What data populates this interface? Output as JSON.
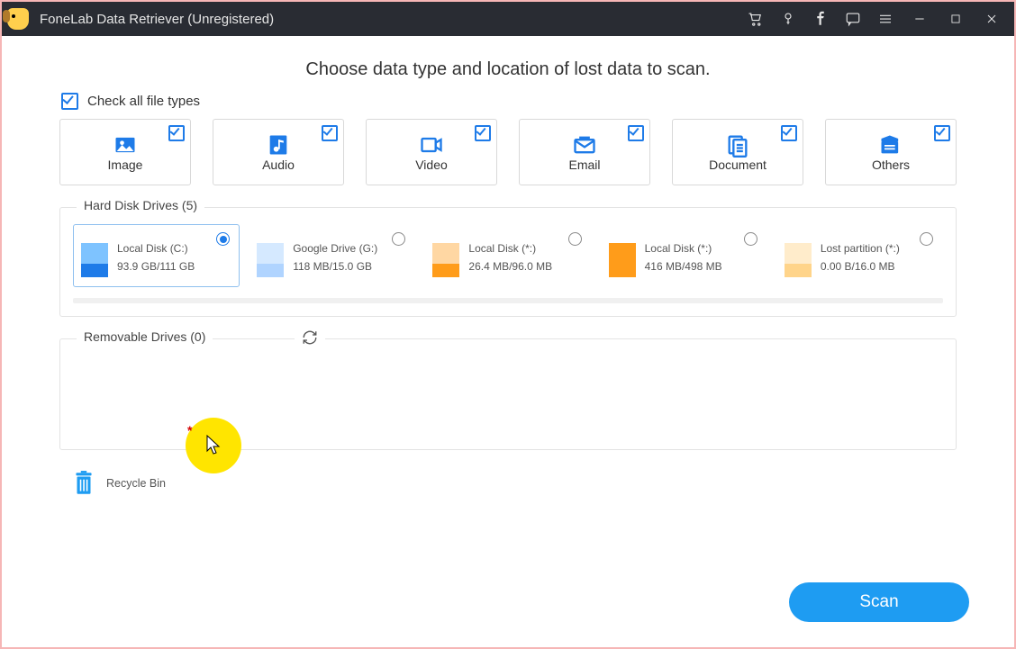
{
  "titlebar": {
    "title": "FoneLab Data Retriever (Unregistered)"
  },
  "headline": "Choose data type and location of lost data to scan.",
  "check_all": {
    "label": "Check all file types"
  },
  "types": [
    {
      "name": "image",
      "label": "Image"
    },
    {
      "name": "audio",
      "label": "Audio"
    },
    {
      "name": "video",
      "label": "Video"
    },
    {
      "name": "email",
      "label": "Email"
    },
    {
      "name": "document",
      "label": "Document"
    },
    {
      "name": "others",
      "label": "Others"
    }
  ],
  "hdd": {
    "legend": "Hard Disk Drives (5)",
    "drives": [
      {
        "name": "Local Disk (C:)",
        "size": "93.9 GB/111 GB",
        "top": "#7ec3ff",
        "bot": "#1e7be8",
        "selected": true
      },
      {
        "name": "Google Drive (G:)",
        "size": "118 MB/15.0 GB",
        "top": "#d5e9ff",
        "bot": "#b0d4ff",
        "selected": false
      },
      {
        "name": "Local Disk (*:)",
        "size": "26.4 MB/96.0 MB",
        "top": "#ffd7a3",
        "bot": "#ff9c1a",
        "selected": false
      },
      {
        "name": "Local Disk (*:)",
        "size": "416 MB/498 MB",
        "top": "#ff9c1a",
        "bot": "#ff9c1a",
        "selected": false
      },
      {
        "name": "Lost partition (*:)",
        "size": "0.00  B/16.0 MB",
        "top": "#ffeccb",
        "bot": "#ffd48a",
        "selected": false
      }
    ]
  },
  "removable": {
    "legend": "Removable Drives (0)"
  },
  "recycle": {
    "label": "Recycle Bin"
  },
  "scan": {
    "label": "Scan"
  }
}
